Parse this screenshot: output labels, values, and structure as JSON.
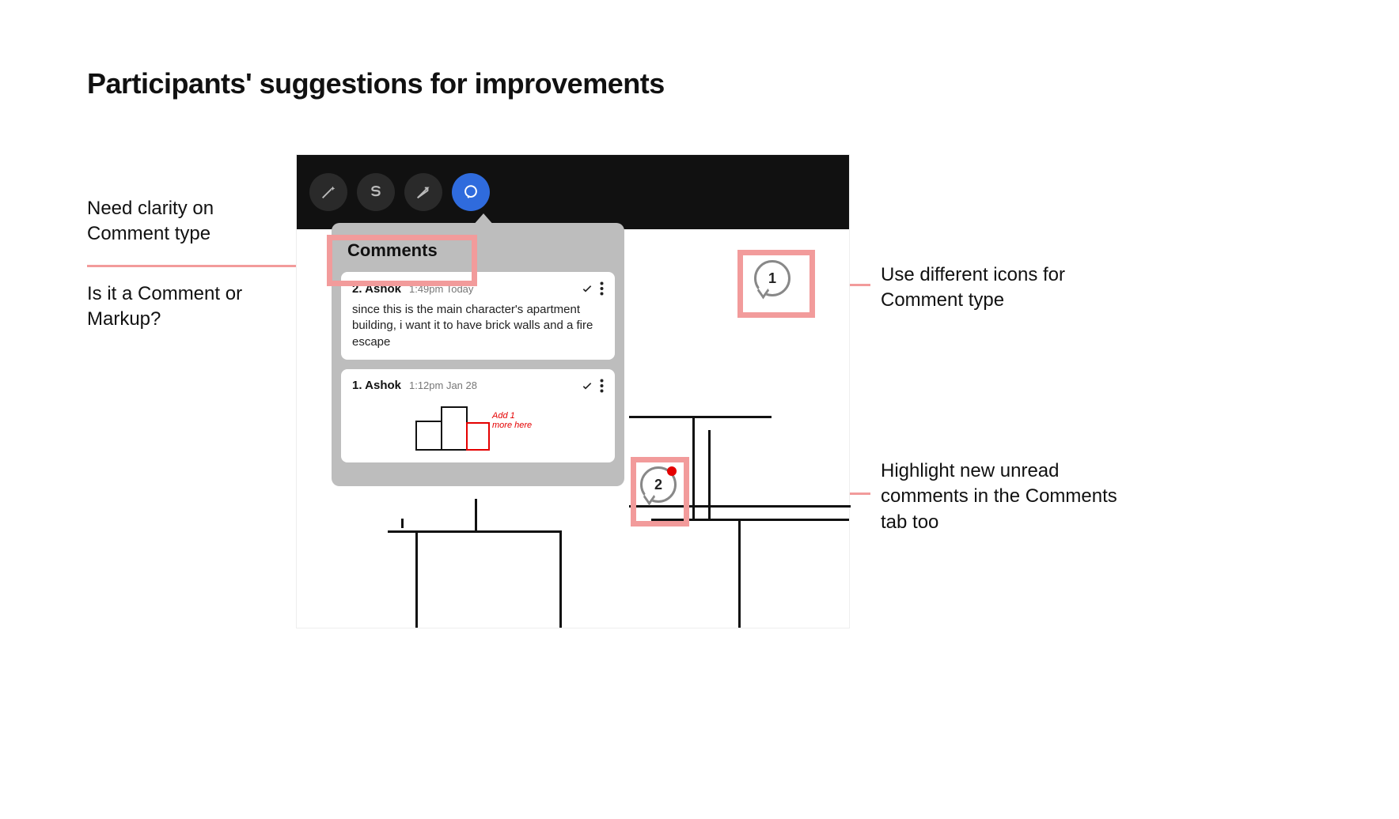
{
  "title": "Participants' suggestions for improvements",
  "annotations": {
    "left1": "Need clarity on Comment type",
    "left2": "Is it a Comment or Markup?",
    "right1": "Use different icons for Comment type",
    "right2": "Highlight new unread comments in the Comments tab too"
  },
  "toolbar": {
    "tools": [
      "magic",
      "s-shape",
      "arrow",
      "comment"
    ],
    "active": "comment"
  },
  "panel": {
    "title": "Comments",
    "comments": [
      {
        "index": "2.",
        "author": "Ashok",
        "time": "1:49pm Today",
        "body": "since this is the main character's apartment building, i want it to have brick walls and a fire escape"
      },
      {
        "index": "1.",
        "author": "Ashok",
        "time": "1:12pm Jan 28",
        "sketch_note": "Add 1 more here"
      }
    ]
  },
  "bubbles": {
    "b1": {
      "number": "1",
      "unread": false
    },
    "b2": {
      "number": "2",
      "unread": true
    }
  }
}
